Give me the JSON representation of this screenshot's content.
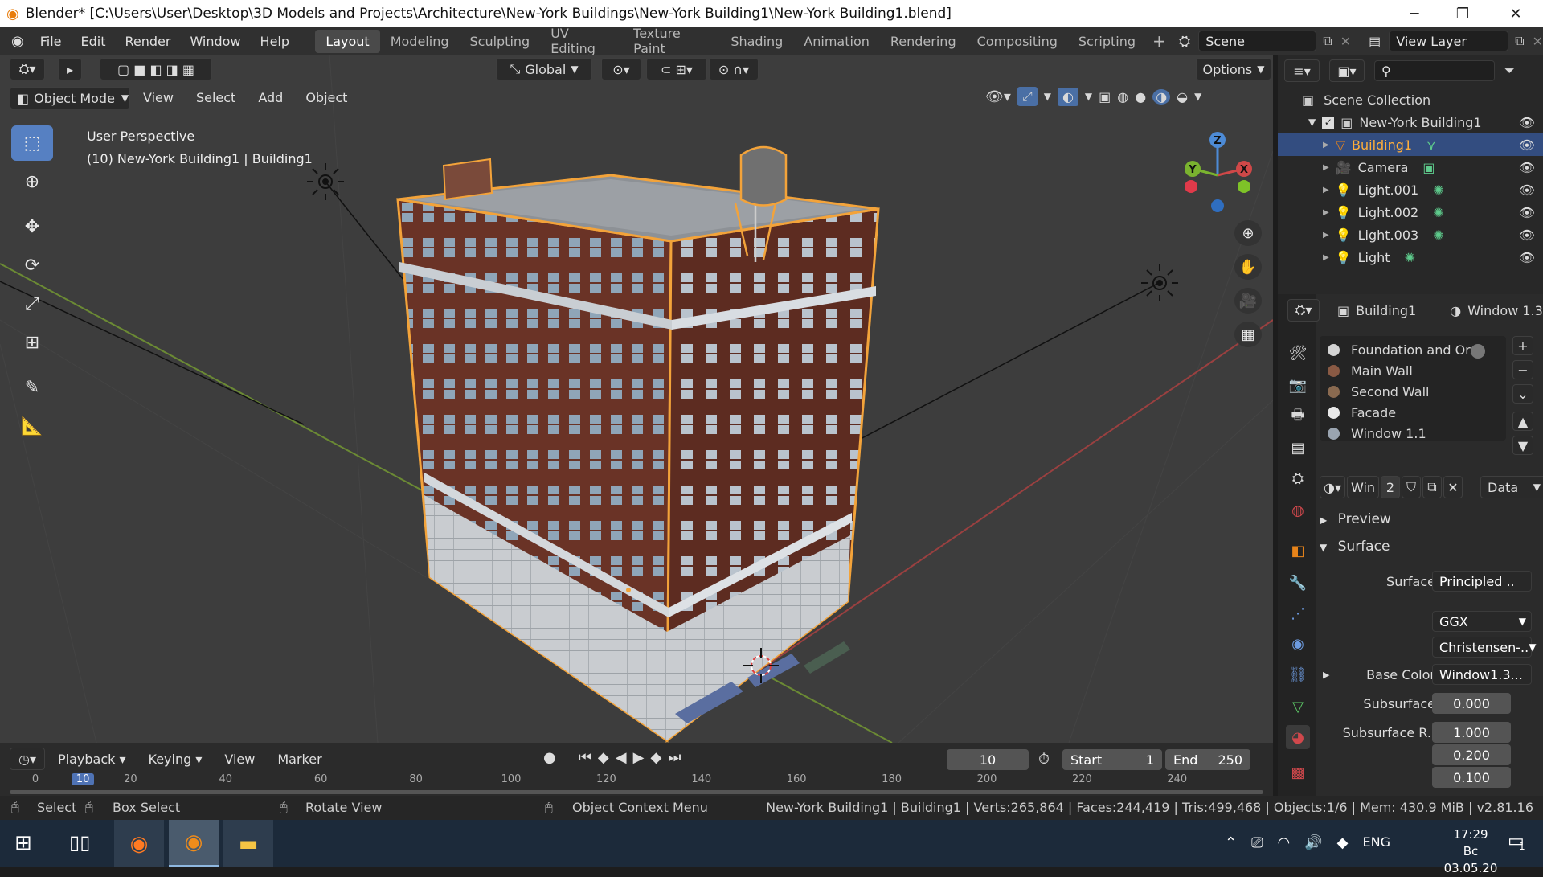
{
  "window": {
    "title": "Blender* [C:\\Users\\User\\Desktop\\3D Models and Projects\\Architecture\\New-York Buildings\\New-York Building1\\New-York Building1.blend]"
  },
  "menu": [
    "File",
    "Edit",
    "Render",
    "Window",
    "Help"
  ],
  "workspaces": [
    "Layout",
    "Modeling",
    "Sculpting",
    "UV Editing",
    "Texture Paint",
    "Shading",
    "Animation",
    "Rendering",
    "Compositing",
    "Scripting"
  ],
  "scene": {
    "name": "Scene",
    "view_layer": "View Layer"
  },
  "viewport": {
    "mode": "Object Mode",
    "menus": [
      "View",
      "Select",
      "Add",
      "Object"
    ],
    "orientation": "Global",
    "options_label": "Options",
    "overlay_line1": "User Perspective",
    "overlay_line2": "(10) New-York Building1 | Building1",
    "gizmo": {
      "x": "X",
      "y": "Y",
      "z": "Z"
    }
  },
  "outliner": {
    "root": "Scene Collection",
    "collection": "New-York Building1",
    "items": [
      {
        "label": "Building1",
        "selected": true
      },
      {
        "label": "Camera",
        "selected": false
      },
      {
        "label": "Light.001",
        "selected": false
      },
      {
        "label": "Light.002",
        "selected": false
      },
      {
        "label": "Light.003",
        "selected": false
      },
      {
        "label": "Light",
        "selected": false
      }
    ]
  },
  "properties": {
    "object": "Building1",
    "material_name": "Window 1.3",
    "slots": [
      {
        "label": "Foundation and Or..",
        "color": "#d4d4d4"
      },
      {
        "label": "Main Wall",
        "color": "#8a5a44"
      },
      {
        "label": "Second Wall",
        "color": "#8a6a50"
      },
      {
        "label": "Facade",
        "color": "#e8e8e8"
      },
      {
        "label": "Window 1.1",
        "color": "#9aa4b0"
      }
    ],
    "mat_short": "Win",
    "users": "2",
    "link": "Data",
    "preview": "Preview",
    "surface_panel": "Surface",
    "surface_label": "Surface",
    "surface_value": "Principled ..",
    "distribution": "GGX",
    "subsurface_method": "Christensen-..",
    "base_color_label": "Base Color",
    "base_color_value": "Window1.3...",
    "subsurface_label": "Subsurface",
    "subsurface_value": "0.000",
    "subsurface_r_label": "Subsurface R..",
    "subsurface_r": [
      "1.000",
      "0.200",
      "0.100"
    ]
  },
  "timeline": {
    "menus": [
      "Playback",
      "Keying",
      "View",
      "Marker"
    ],
    "frame": "10",
    "start_label": "Start",
    "start": "1",
    "end_label": "End",
    "end": "250",
    "ticks": [
      "0",
      "10",
      "20",
      "40",
      "60",
      "80",
      "100",
      "120",
      "140",
      "160",
      "180",
      "200",
      "220",
      "240"
    ]
  },
  "status": {
    "select": "Select",
    "box_select": "Box Select",
    "rotate": "Rotate View",
    "context": "Object Context Menu",
    "stats": "New-York Building1 | Building1 | Verts:265,864 | Faces:244,419 | Tris:499,468 | Objects:1/6 | Mem: 430.9 MiB | v2.81.16"
  },
  "taskbar": {
    "time": "17:29",
    "date": "Вс 03.05.20",
    "lang": "ENG",
    "notif": "1"
  }
}
